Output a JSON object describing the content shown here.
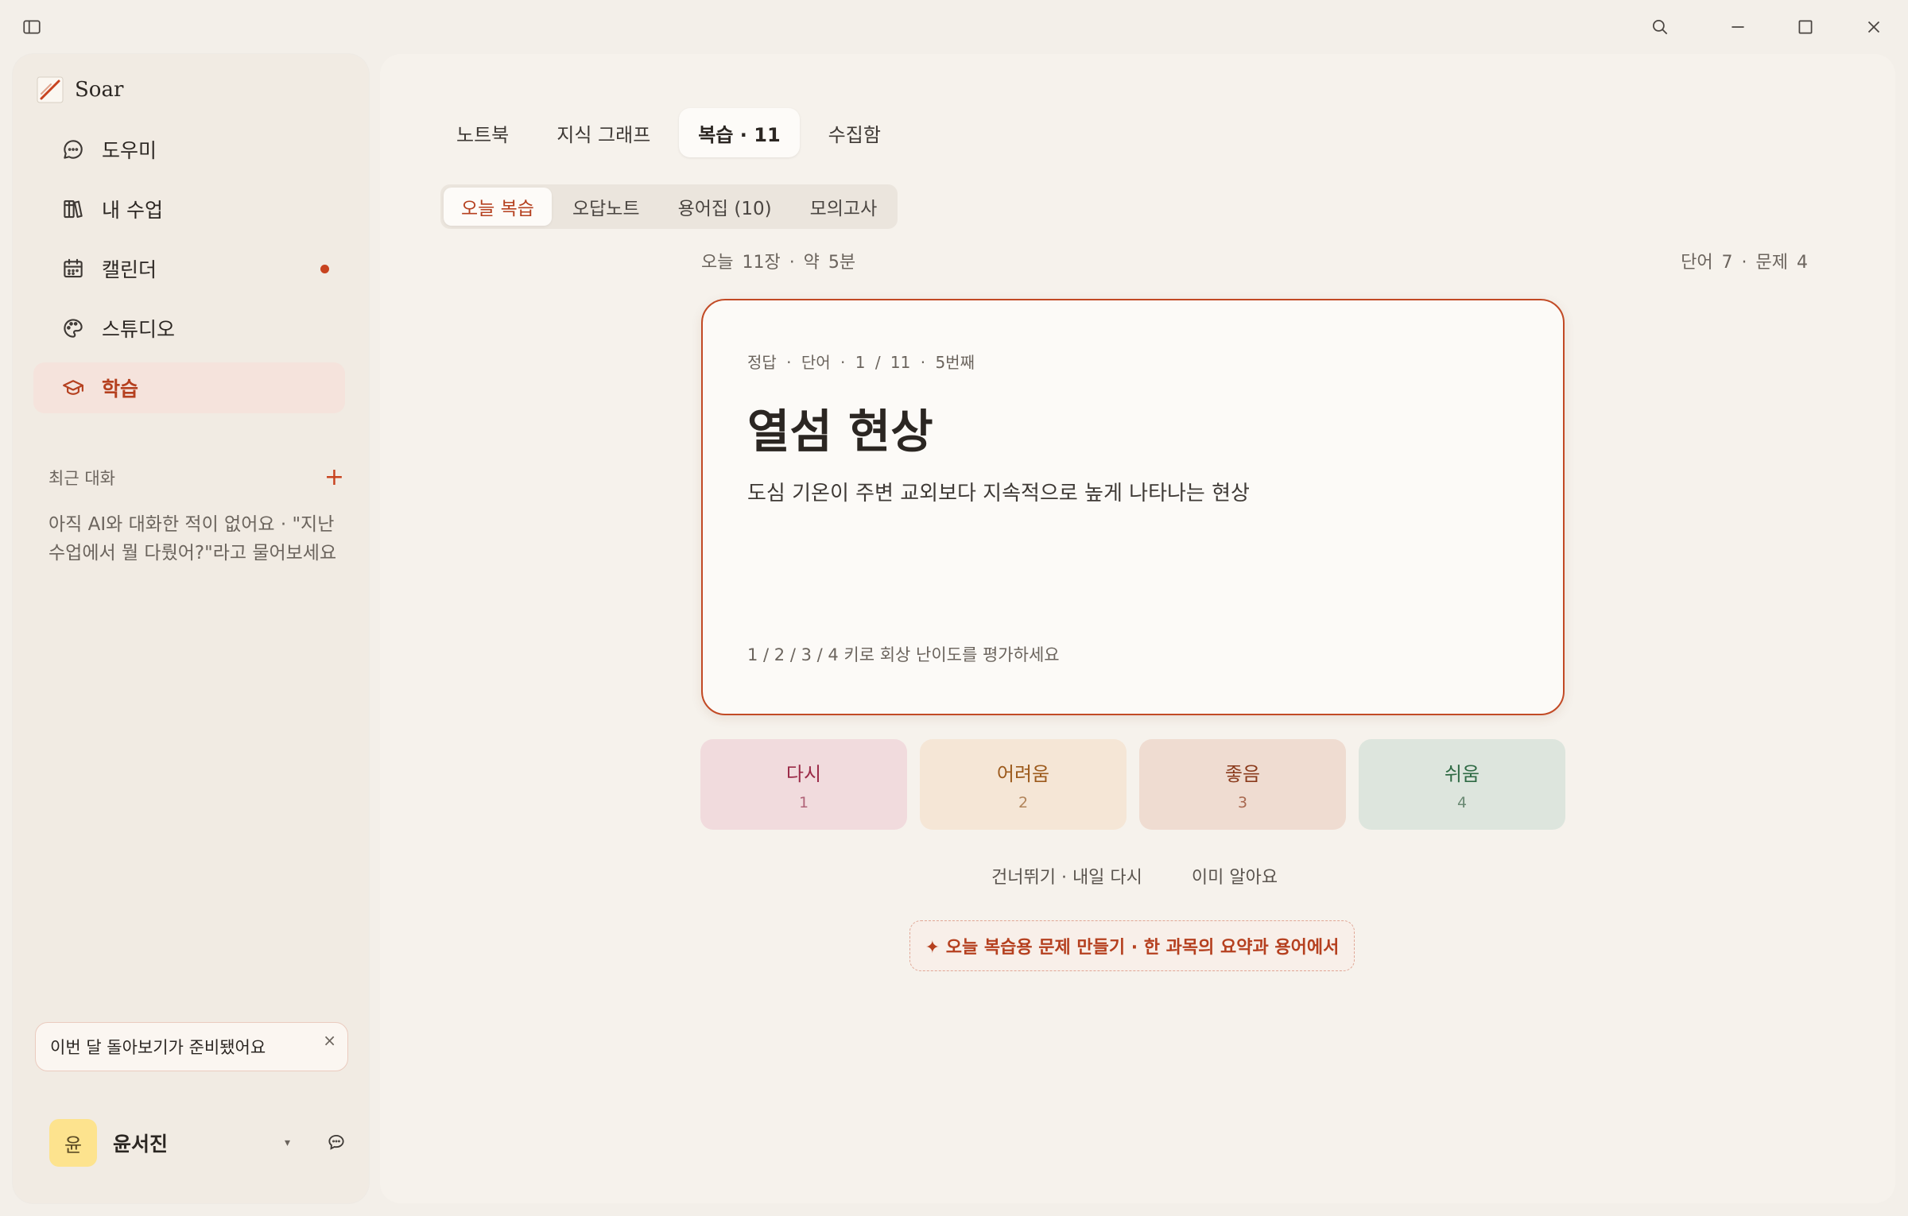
{
  "app": {
    "name": "Soar"
  },
  "sidebar": {
    "items": [
      {
        "label": "도우미",
        "icon": "chat-bubble-icon"
      },
      {
        "label": "내 수업",
        "icon": "books-icon"
      },
      {
        "label": "캘린더",
        "icon": "calendar-icon",
        "has_dot": true
      },
      {
        "label": "스튜디오",
        "icon": "palette-icon"
      },
      {
        "label": "학습",
        "icon": "graduation-cap-icon",
        "active": true
      }
    ],
    "recent_title": "최근 대화",
    "recent_add": "+",
    "recent_empty": "아직 AI와 대화한 적이 없어요 · \"지난 수업에서 뭘 다뤘어?\"라고 물어보세요",
    "notice": {
      "text": "이번 달 돌아보기가 준비됐어요",
      "close": "×"
    },
    "user": {
      "avatar": "윤",
      "name": "윤서진",
      "caret": "▾"
    }
  },
  "main": {
    "tabs": [
      {
        "label": "노트북"
      },
      {
        "label": "지식 그래프"
      },
      {
        "label": "복습 · 11",
        "active": true
      },
      {
        "label": "수집함"
      }
    ],
    "subtabs": [
      {
        "label": "오늘 복습",
        "active": true
      },
      {
        "label": "오답노트"
      },
      {
        "label": "용어집 (10)"
      },
      {
        "label": "모의고사"
      }
    ],
    "stats_left": "오늘 11장 · 약 5분",
    "stats_right": "단어 7 · 문제 4",
    "card": {
      "meta": "정답 · 단어 · 1 / 11 · 5번째",
      "term": "열섬 현상",
      "definition": "도심 기온이 주변 교외보다 지속적으로 높게 나타나는 현상",
      "hint": "1 / 2 / 3 / 4 키로 회상 난이도를 평가하세요"
    },
    "ratings": [
      {
        "label": "다시",
        "key": "1"
      },
      {
        "label": "어려움",
        "key": "2"
      },
      {
        "label": "좋음",
        "key": "3"
      },
      {
        "label": "쉬움",
        "key": "4"
      }
    ],
    "skip_label": "건너뛰기 · 내일 다시",
    "known_label": "이미 알아요",
    "generate_label": "✦ 오늘 복습용 문제 만들기 · 한 과목의 요약과 용어에서"
  },
  "colors": {
    "accent": "#c8431f",
    "background": "#f3efe9"
  }
}
